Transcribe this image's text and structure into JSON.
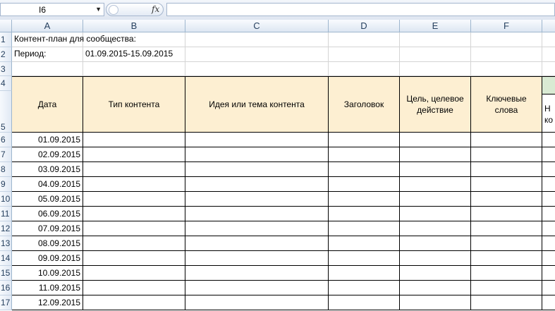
{
  "formula_bar": {
    "name_box": "I6",
    "fx_label": "fx",
    "formula": ""
  },
  "columns": [
    "A",
    "B",
    "C",
    "D",
    "E",
    "F"
  ],
  "rows": [
    "1",
    "2",
    "3",
    "4",
    "5",
    "6",
    "7",
    "8",
    "9",
    "10",
    "11",
    "12",
    "13",
    "14",
    "15",
    "16",
    "17"
  ],
  "sheet": {
    "a1": "Контент-план для сообщества:",
    "a2": "Период:",
    "b2": "01.09.2015-15.09.2015",
    "headers": [
      "Дата",
      "Тип контента",
      "Идея или тема контента",
      "Заголовок",
      "Цель, целевое действие",
      "Ключевые слова"
    ],
    "partial_header": [
      "Н",
      "ко"
    ],
    "dates": [
      "01.09.2015",
      "02.09.2015",
      "03.09.2015",
      "04.09.2015",
      "05.09.2015",
      "06.09.2015",
      "07.09.2015",
      "08.09.2015",
      "09.09.2015",
      "10.09.2015",
      "11.09.2015",
      "12.09.2015"
    ]
  },
  "colors": {
    "header_fill": "#fdefd2",
    "partial_header_fill": "#d9ead3",
    "grid_line": "#d4d4d4"
  }
}
